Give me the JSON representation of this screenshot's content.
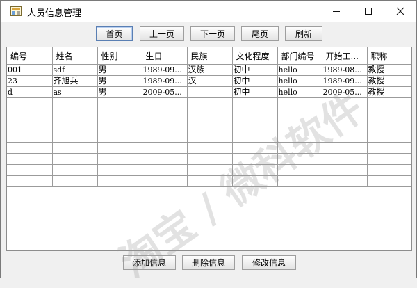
{
  "window": {
    "title": "人员信息管理",
    "minimize": "—",
    "maximize": "☐",
    "close": "✕"
  },
  "toolbar": {
    "first_label": "首页",
    "prev_label": "上一页",
    "next_label": "下一页",
    "last_label": "尾页",
    "refresh_label": "刷新"
  },
  "table": {
    "columns": [
      "编号",
      "姓名",
      "性别",
      "生日",
      "民族",
      "文化程度",
      "部门编号",
      "开始工...",
      "职称"
    ],
    "rows": [
      [
        "001",
        "sdf",
        "男",
        "1989-09...",
        "汉族",
        "初中",
        "hello",
        "1989-08...",
        "教授"
      ],
      [
        "23",
        "齐旭兵",
        "男",
        "1989-09...",
        "汉",
        "初中",
        "hello",
        "1989-09...",
        "教授"
      ],
      [
        "d",
        "as",
        "男",
        "2009-05...",
        "",
        "初中",
        "hello",
        "2009-05...",
        "教授"
      ]
    ],
    "empty_rows": 8
  },
  "footer": {
    "add_label": "添加信息",
    "delete_label": "删除信息",
    "edit_label": "修改信息"
  },
  "watermark": "淘宝 / 微科软件",
  "colors": {
    "window_bg": "#ffffff",
    "client_bg": "#f0f0f0",
    "grid": "#9b9b9b",
    "focus_border": "#5a7fb3"
  }
}
